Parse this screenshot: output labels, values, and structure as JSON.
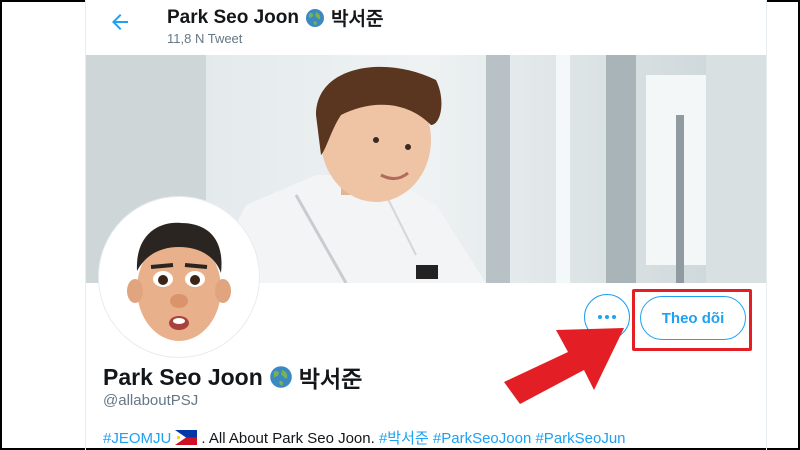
{
  "header": {
    "title": "Park Seo Joon",
    "title_korean": "박서준",
    "tweet_count": "11,8 N Tweet",
    "back_icon": "arrow-left-icon",
    "globe_icon": "globe-icon"
  },
  "profile": {
    "name": "Park Seo Joon",
    "name_korean": "박서준",
    "handle": "@allaboutPSJ",
    "bio": {
      "tag1": "#JEOMJU",
      "text": ". All About Park Seo Joon. ",
      "tag2": "#박서준",
      "tag3": "#ParkSeoJoon",
      "tag4": "#ParkSeoJun"
    }
  },
  "actions": {
    "more_icon": "more-horizontal-icon",
    "follow_label": "Theo dõi"
  },
  "colors": {
    "accent": "#1da1f2",
    "highlight": "#e31e24",
    "text": "#14171a",
    "muted": "#657786"
  }
}
